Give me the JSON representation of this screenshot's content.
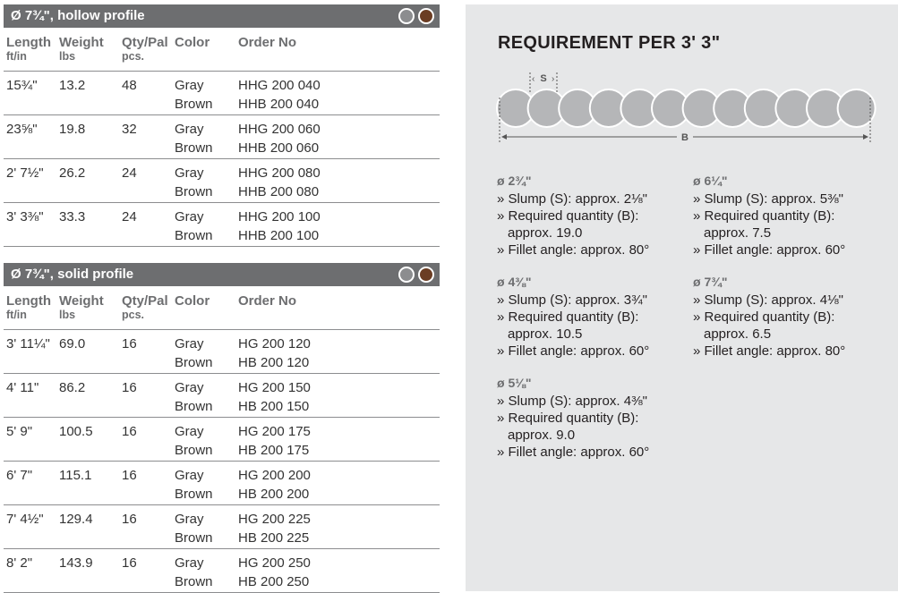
{
  "colors": {
    "header_bg": "#6d6e70",
    "gray_swatch": "#8c8d8f",
    "brown_swatch": "#6b3d23",
    "panel_bg": "#e6e7e8",
    "circle": "#b5b6b8"
  },
  "columns": {
    "length": "Length",
    "length_unit": "ft/in",
    "weight": "Weight",
    "weight_unit": "lbs",
    "qty": "Qty/Pal",
    "qty_unit": "pcs.",
    "color": "Color",
    "order": "Order No"
  },
  "hollow": {
    "title": "Ø 7¾\", hollow profile",
    "rows": [
      {
        "length": "15¾\"",
        "weight": "13.2",
        "qty": "48",
        "color1": "Gray",
        "color2": "Brown",
        "order1": "HHG 200 040",
        "order2": "HHB 200 040"
      },
      {
        "length": "23⅝\"",
        "weight": "19.8",
        "qty": "32",
        "color1": "Gray",
        "color2": "Brown",
        "order1": "HHG 200 060",
        "order2": "HHB 200 060"
      },
      {
        "length": "2' 7½\"",
        "weight": "26.2",
        "qty": "24",
        "color1": "Gray",
        "color2": "Brown",
        "order1": "HHG 200 080",
        "order2": "HHB 200 080"
      },
      {
        "length": "3' 3⅜\"",
        "weight": "33.3",
        "qty": "24",
        "color1": "Gray",
        "color2": "Brown",
        "order1": "HHG 200 100",
        "order2": "HHB 200 100"
      }
    ]
  },
  "solid": {
    "title": "Ø 7¾\", solid profile",
    "rows": [
      {
        "length": "3' 11¼\"",
        "weight": "69.0",
        "qty": "16",
        "color1": "Gray",
        "color2": "Brown",
        "order1": "HG 200 120",
        "order2": "HB 200 120"
      },
      {
        "length": "4' 11\"",
        "weight": "86.2",
        "qty": "16",
        "color1": "Gray",
        "color2": "Brown",
        "order1": "HG 200 150",
        "order2": "HB 200 150"
      },
      {
        "length": "5' 9\"",
        "weight": "100.5",
        "qty": "16",
        "color1": "Gray",
        "color2": "Brown",
        "order1": "HG 200 175",
        "order2": "HB 200 175"
      },
      {
        "length": "6' 7\"",
        "weight": "115.1",
        "qty": "16",
        "color1": "Gray",
        "color2": "Brown",
        "order1": "HG 200 200",
        "order2": "HB 200 200"
      },
      {
        "length": "7' 4½\"",
        "weight": "129.4",
        "qty": "16",
        "color1": "Gray",
        "color2": "Brown",
        "order1": "HG 200 225",
        "order2": "HB 200 225"
      },
      {
        "length": "8' 2\"",
        "weight": "143.9",
        "qty": "16",
        "color1": "Gray",
        "color2": "Brown",
        "order1": "HG 200 250",
        "order2": "HB 200 250"
      }
    ]
  },
  "requirement": {
    "title": "REQUIREMENT PER 3' 3\"",
    "label_s": "S",
    "label_b": "B",
    "specs": [
      {
        "diameter": "ø 2¾\"",
        "slump": "» Slump (S): approx. 2⅛\"",
        "qty_label": "» Required quantity (B):",
        "qty_value": "approx. 19.0",
        "fillet": "» Fillet angle: approx. 80°"
      },
      {
        "diameter": "ø 4⅜\"",
        "slump": "» Slump (S): approx. 3¾\"",
        "qty_label": "» Required quantity (B):",
        "qty_value": "approx. 10.5",
        "fillet": "» Fillet angle: approx. 60°"
      },
      {
        "diameter": "ø 5⅛\"",
        "slump": "» Slump (S): approx. 4⅜\"",
        "qty_label": "» Required quantity (B):",
        "qty_value": "approx. 9.0",
        "fillet": "» Fillet angle: approx. 60°"
      },
      {
        "diameter": "ø 6¼\"",
        "slump": "» Slump (S): approx. 5⅜\"",
        "qty_label": "» Required quantity (B):",
        "qty_value": "approx. 7.5",
        "fillet": "» Fillet angle: approx. 60°"
      },
      {
        "diameter": "ø 7¾\"",
        "slump": "» Slump (S): approx. 4⅛\"",
        "qty_label": "» Required quantity (B):",
        "qty_value": "approx. 6.5",
        "fillet": "» Fillet angle: approx. 80°"
      }
    ]
  }
}
